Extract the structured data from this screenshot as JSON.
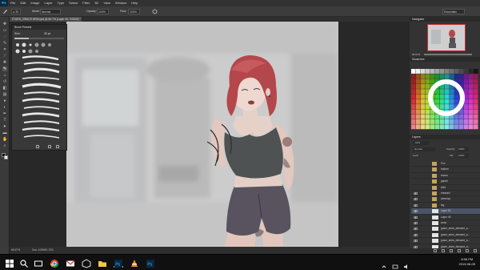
{
  "menu": {
    "app_logo": "Ps",
    "items": [
      "File",
      "Edit",
      "Image",
      "Layer",
      "Type",
      "Select",
      "Filter",
      "3D",
      "View",
      "Window",
      "Help"
    ]
  },
  "options": {
    "mode_label": "Mode:",
    "mode_value": "Normal",
    "opacity_label": "Opacity:",
    "opacity_value": "100%",
    "flow_label": "Flow:",
    "flow_value": "100%",
    "workspace_value": "Essentials"
  },
  "document": {
    "tab_title": "STARS_GRACE NEW.psd @ 66.7% (Layer 50, RGB/8) *",
    "zoom": "66.67%",
    "doc_info": "Doc: 6.59M/1.75G"
  },
  "brush_panel": {
    "title": "Brush Presets",
    "size_label": "Size:",
    "size_value": "35 px"
  },
  "panels": {
    "navigator_title": "Navigator",
    "navigator_zoom": "66.67%",
    "swatches_title": "Swatches",
    "layers_title": "Layers",
    "kind_label": "Kind",
    "blend_mode": "Normal",
    "opacity_label": "Opacity:",
    "opacity_value": "100%",
    "lock_label": "Lock:",
    "fill_label": "Fill:",
    "fill_value": "100%"
  },
  "layers": [
    {
      "name": "Fon",
      "type": "folder",
      "visible": false
    },
    {
      "name": "bottom",
      "type": "folder",
      "visible": false
    },
    {
      "name": "shorts",
      "type": "folder",
      "visible": false
    },
    {
      "name": "ganhb",
      "type": "folder",
      "visible": false
    },
    {
      "name": "shirt",
      "type": "folder",
      "visible": false
    },
    {
      "name": "dressed",
      "type": "folder",
      "visible": true
    },
    {
      "name": "seremys",
      "type": "folder",
      "visible": true
    },
    {
      "name": "leg",
      "type": "folder",
      "visible": true
    },
    {
      "name": "Layer 50",
      "type": "layer",
      "visible": true
    },
    {
      "name": "Layer 49",
      "type": "layer",
      "visible": true
    },
    {
      "name": "arms",
      "type": "layer",
      "visible": true
    },
    {
      "name": "grace_arms_dressed_a...",
      "type": "layer",
      "visible": true
    },
    {
      "name": "grace_arms_dressed_a...",
      "type": "layer",
      "visible": true
    },
    {
      "name": "grace_arms_dressed_a...",
      "type": "layer",
      "visible": true
    },
    {
      "name": "grace_arms_dressed_a...",
      "type": "layer",
      "visible": true
    },
    {
      "name": "grace_arms_dressed_a...",
      "type": "layer",
      "visible": true
    }
  ],
  "taskbar": {
    "time": "8:55 PM",
    "date": "2019-06-05",
    "apps": [
      "start",
      "search",
      "task-view",
      "chrome",
      "gmail",
      "unity",
      "folder",
      "photoshop",
      "vlc",
      "photoshop-2"
    ]
  },
  "colors": {
    "ps_blue": "#35c1f3",
    "hair": "#b4474b",
    "shirt": "#4f5253",
    "shorts": "#58535f",
    "skin": "#e4cfc6"
  }
}
